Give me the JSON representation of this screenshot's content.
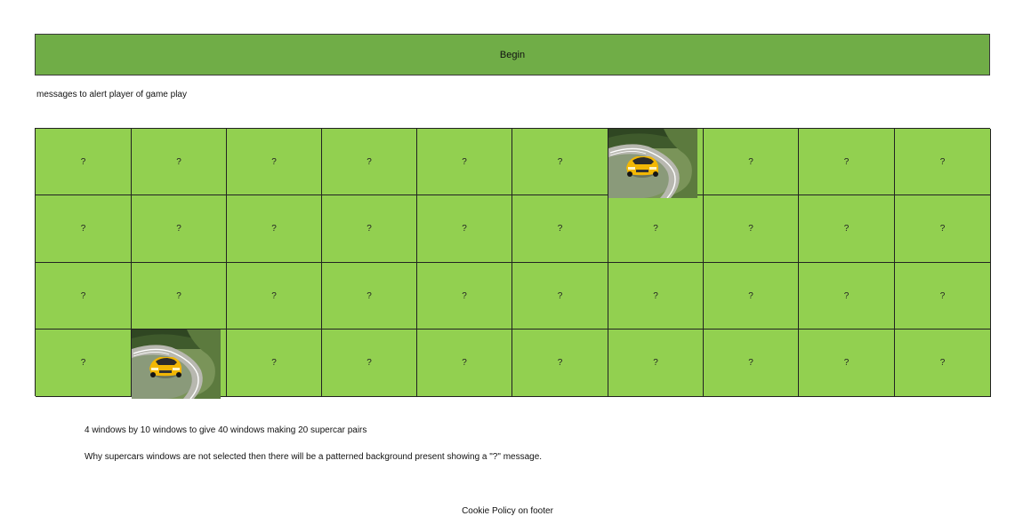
{
  "begin_label": "Begin",
  "messages_text": "messages to alert player of game play",
  "board": {
    "rows": 4,
    "cols": 10,
    "hidden_label": "?",
    "revealed": [
      {
        "row": 0,
        "col": 6,
        "image": "yellow supercar on winding road"
      },
      {
        "row": 3,
        "col": 1,
        "image": "yellow supercar on winding road"
      }
    ]
  },
  "info": {
    "line1": "4 windows by 10 windows to give 40 windows making 20 supercar pairs",
    "line2": "Why supercars windows are not selected then there will be a patterned background present showing a \"?\" message."
  },
  "footer_text": "Cookie Policy on footer",
  "colors": {
    "begin_bar": "#70ad47",
    "tile": "#92d050",
    "car": "#f2b705"
  }
}
